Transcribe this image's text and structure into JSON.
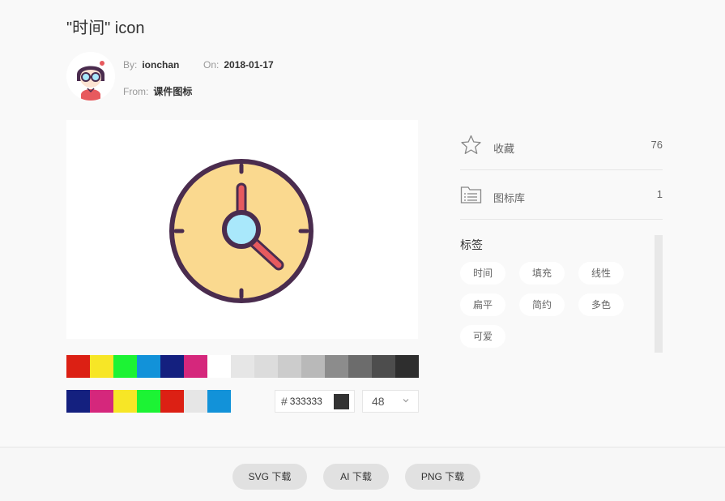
{
  "header": {
    "title": "\"时间\" icon"
  },
  "meta": {
    "by_label": "By:",
    "author": "ionchan",
    "on_label": "On:",
    "date": "2018-01-17",
    "from_label": "From:",
    "source": "课件图标"
  },
  "palette_top": [
    "#dc2014",
    "#f7e626",
    "#1cf334",
    "#1292d9",
    "#14207f",
    "#d5277c",
    "#ffffff",
    "#e6e6e6",
    "#dcdcdc",
    "#cccccc",
    "#b9b9b9",
    "#8c8c8c",
    "#6c6c6c",
    "#4d4d4d",
    "#2e2e2e"
  ],
  "palette_bottom": [
    "#14207f",
    "#d5277c",
    "#f7e626",
    "#1cf334",
    "#dc2014",
    "#e6e6e6",
    "#1292d9"
  ],
  "color_input": {
    "hash": "#",
    "value": "333333",
    "color": "#333333"
  },
  "size_select": {
    "value": "48"
  },
  "side": {
    "favorite": {
      "label": "收藏",
      "count": "76"
    },
    "library": {
      "label": "图标库",
      "count": "1"
    }
  },
  "tags": {
    "title": "标签",
    "items": [
      "时间",
      "填充",
      "线性",
      "扁平",
      "简约",
      "多色",
      "可爱"
    ]
  },
  "downloads": {
    "svg": "SVG 下载",
    "ai": "AI 下载",
    "png": "PNG 下载"
  },
  "icon_colors": {
    "face": "#fad98f",
    "outline": "#4a2c4e",
    "hand": "#e75a5e",
    "center": "#a9e8fb"
  }
}
